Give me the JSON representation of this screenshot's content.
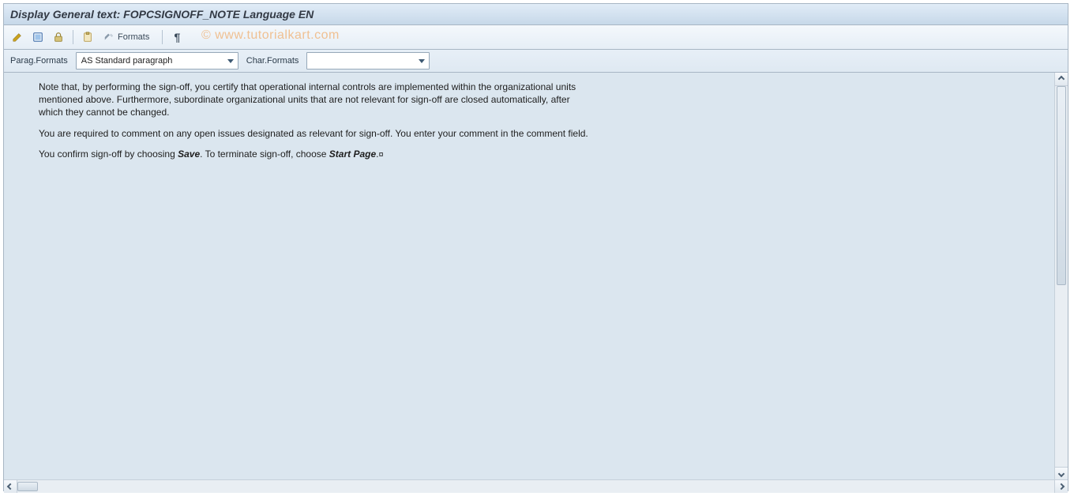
{
  "title": "Display General text: FOPCSIGNOFF_NOTE Language EN",
  "watermark": "© www.tutorialkart.com",
  "toolbar": {
    "formats_label": "Formats",
    "pilcrow": "¶"
  },
  "formats_bar": {
    "parag_label": "Parag.Formats",
    "parag_value": "AS Standard paragraph",
    "char_label": "Char.Formats",
    "char_value": ""
  },
  "doc": {
    "p1": "Note that, by performing the sign-off, you certify that operational internal controls are implemented within the organizational units mentioned above. Furthermore, subordinate organizational units that are not relevant for sign-off are closed automatically, after which they cannot be changed.",
    "p2": "You are required to comment on any open issues designated as relevant for sign-off. You enter your comment in the comment field.",
    "p3_a": "You confirm sign-off by choosing ",
    "p3_save": "Save",
    "p3_b": ". To terminate sign-off, choose ",
    "p3_start": "Start Page",
    "p3_c": ".",
    "endmark": "¤"
  }
}
